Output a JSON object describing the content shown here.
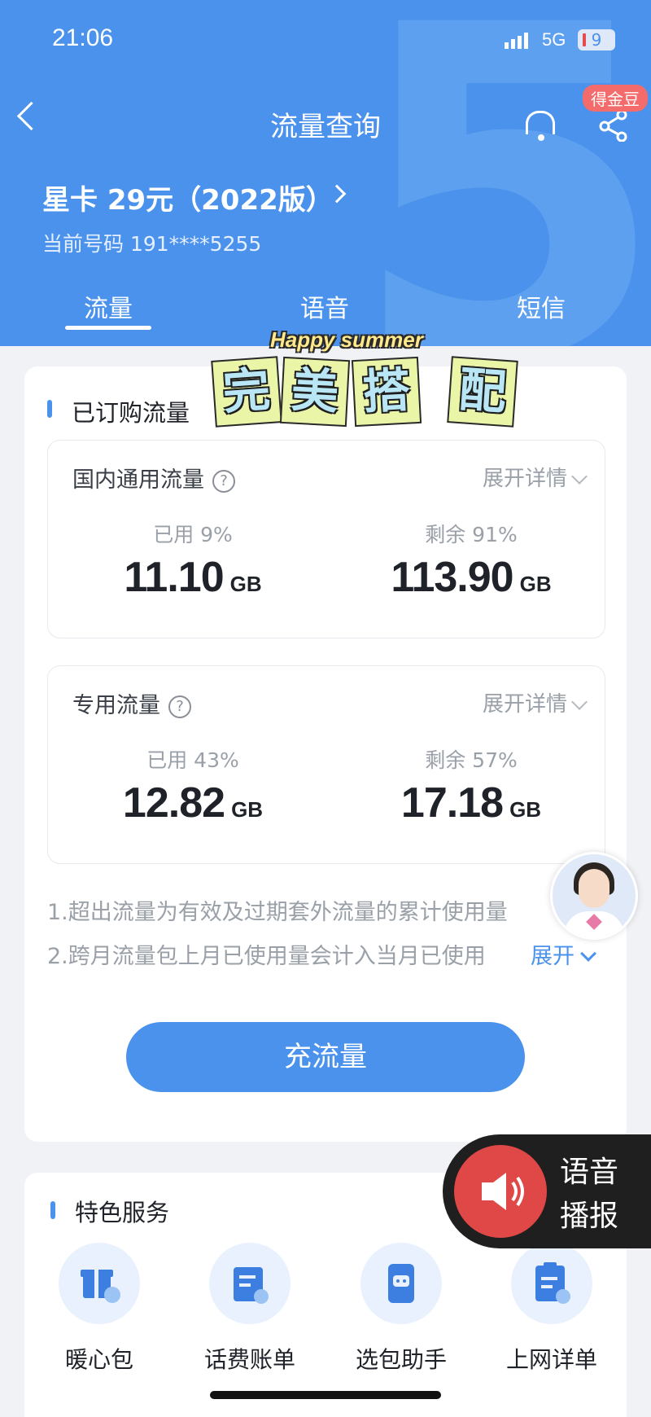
{
  "status": {
    "time": "21:06",
    "network": "5G",
    "battery": "9"
  },
  "header": {
    "title": "流量查询",
    "badge": "得金豆",
    "plan_name": "星卡 29元（2022版）",
    "phone_label": "当前号码 191****5255"
  },
  "tabs": [
    {
      "label": "流量"
    },
    {
      "label": "语音"
    },
    {
      "label": "短信"
    }
  ],
  "sticker": {
    "subtitle": "Happy summer",
    "chars": [
      "完",
      "美",
      "搭",
      "配"
    ]
  },
  "purchased": {
    "section_title": "已订购流量",
    "general": {
      "title": "国内通用流量",
      "expand": "展开详情",
      "used_label": "已用 9%",
      "used_value": "11.10",
      "remain_label": "剩余 91%",
      "remain_value": "113.90",
      "unit": "GB"
    },
    "dedicated": {
      "title": "专用流量",
      "expand": "展开详情",
      "used_label": "已用 43%",
      "used_value": "12.82",
      "remain_label": "剩余 57%",
      "remain_value": "17.18",
      "unit": "GB"
    },
    "notes": [
      "1.超出流量为有效及过期套外流量的累计使用量",
      "2.跨月流量包上月已使用量会计入当月已使用"
    ],
    "notes_expand": "展开",
    "recharge_button": "充流量"
  },
  "services": {
    "section_title": "特色服务",
    "items": [
      {
        "label": "暖心包"
      },
      {
        "label": "话费账单"
      },
      {
        "label": "选包助手"
      },
      {
        "label": "上网详单"
      }
    ]
  },
  "voice_broadcast": {
    "line1": "语音",
    "line2": "播报"
  }
}
